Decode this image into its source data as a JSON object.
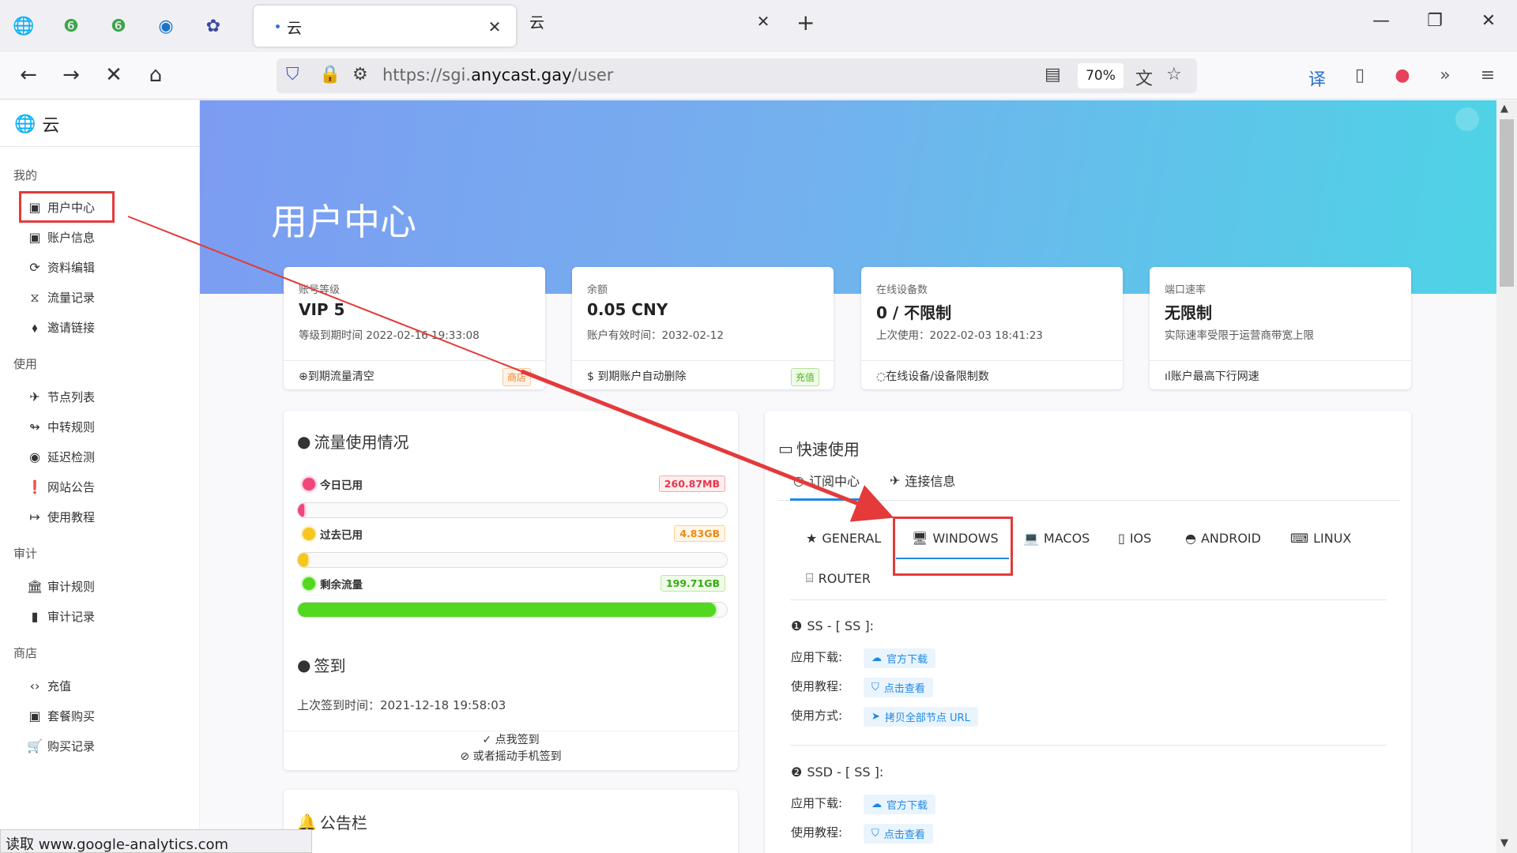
{
  "browser": {
    "tab_active_title": "云",
    "tab_inactive_title": "云",
    "url_prefix": "https://sgi.",
    "url_domain": "anycast.gay",
    "url_path": "/user",
    "zoom": "70%",
    "status_text": "读取 www.google-analytics.com"
  },
  "sidebar": {
    "brand": "云",
    "sections": [
      {
        "title": "我的",
        "items": [
          {
            "label": "用户中心",
            "icon": "dashboard-icon"
          },
          {
            "label": "账户信息",
            "icon": "user-icon"
          },
          {
            "label": "资料编辑",
            "icon": "sync-icon"
          },
          {
            "label": "流量记录",
            "icon": "hourglass-icon"
          },
          {
            "label": "邀请链接",
            "icon": "tag-icon"
          }
        ]
      },
      {
        "title": "使用",
        "items": [
          {
            "label": "节点列表",
            "icon": "plane-icon"
          },
          {
            "label": "中转规则",
            "icon": "relay-icon"
          },
          {
            "label": "延迟检测",
            "icon": "eye-icon"
          },
          {
            "label": "网站公告",
            "icon": "announcement-icon"
          },
          {
            "label": "使用教程",
            "icon": "login-icon"
          }
        ]
      },
      {
        "title": "审计",
        "items": [
          {
            "label": "审计规则",
            "icon": "bank-icon"
          },
          {
            "label": "审计记录",
            "icon": "report-icon"
          }
        ]
      },
      {
        "title": "商店",
        "items": [
          {
            "label": "充值",
            "icon": "code-icon"
          },
          {
            "label": "套餐购买",
            "icon": "shop-icon"
          },
          {
            "label": "购买记录",
            "icon": "cart-icon"
          }
        ]
      }
    ]
  },
  "hero": {
    "title": "用户中心"
  },
  "stats": [
    {
      "label": "账号等级",
      "value": "VIP 5",
      "sub": "等级到期时间 2022-02-16 19:33:08",
      "footer": "到期流量清空",
      "badge": "商店"
    },
    {
      "label": "余额",
      "value": "0.05 CNY",
      "sub": "账户有效时间：2032-02-12",
      "footer": "到期账户自动删除",
      "badge": "充值"
    },
    {
      "label": "在线设备数",
      "value": "0 / 不限制",
      "sub": "上次使用：2022-02-03 18:41:23",
      "footer": "在线设备/设备限制数",
      "badge": ""
    },
    {
      "label": "端口速率",
      "value": "无限制",
      "sub": "实际速率受限于运营商带宽上限",
      "footer": "账户最高下行网速",
      "badge": ""
    }
  ],
  "traffic": {
    "title": "流量使用情况",
    "rows": [
      {
        "label": "今日已用",
        "amount": "260.87MB",
        "fraction": 0.001,
        "color": "#f0477a"
      },
      {
        "label": "过去已用",
        "amount": "4.83GB",
        "fraction": 0.024,
        "color": "#f6c61e"
      },
      {
        "label": "剩余流量",
        "amount": "199.71GB",
        "fraction": 0.975,
        "color": "#52d81e"
      }
    ]
  },
  "checkin": {
    "title": "签到",
    "last_time": "上次签到时间：2021-12-18 19:58:03",
    "action": "点我签到",
    "alt_action": "或者摇动手机签到"
  },
  "notice": {
    "title": "公告栏"
  },
  "quick": {
    "title": "快速使用",
    "tabs": [
      "订阅中心",
      "连接信息"
    ],
    "os_tabs": [
      "GENERAL",
      "WINDOWS",
      "MACOS",
      "IOS",
      "ANDROID",
      "LINUX",
      "ROUTER"
    ],
    "selected_os": "WINDOWS",
    "configs": [
      {
        "title": "SS - [ SS ]:",
        "rows": [
          {
            "label": "应用下载:",
            "action": "官方下载"
          },
          {
            "label": "使用教程:",
            "action": "点击查看"
          },
          {
            "label": "使用方式:",
            "action": "拷贝全部节点 URL"
          }
        ]
      },
      {
        "title": "SSD - [ SS ]:",
        "rows": [
          {
            "label": "应用下载:",
            "action": "官方下载"
          },
          {
            "label": "使用教程:",
            "action": "点击查看"
          }
        ]
      }
    ]
  },
  "colors": {
    "accent": "#1e88e5",
    "highlight": "#e43a3a",
    "hero_start": "#7c9cf2",
    "hero_end": "#4dd4e6"
  }
}
